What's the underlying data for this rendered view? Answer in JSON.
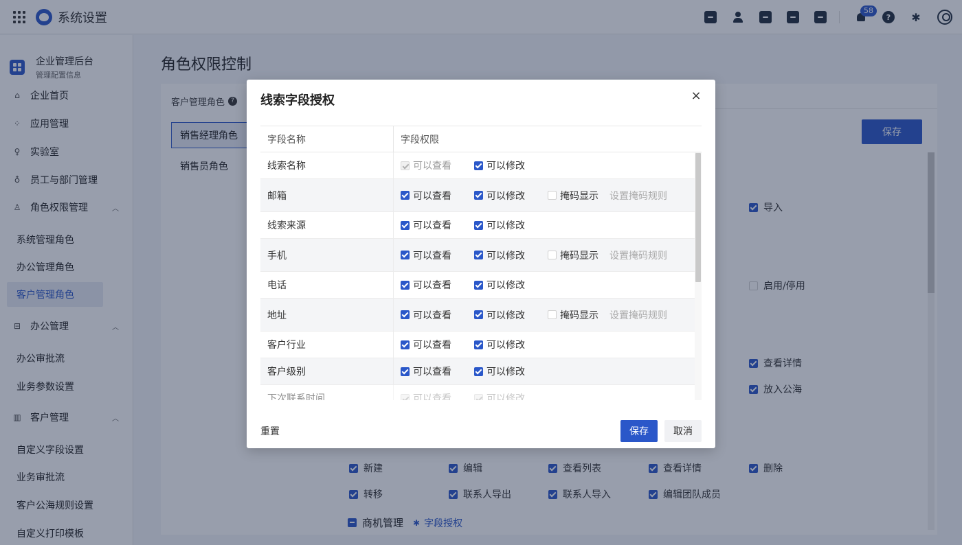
{
  "app": {
    "title": "系统设置",
    "notification_count": "58"
  },
  "sidebar": {
    "org_name": "企业管理后台",
    "org_sub": "管理配置信息",
    "items": [
      {
        "label": "企业首页",
        "icon": "home-icon",
        "glyph": "⌂"
      },
      {
        "label": "应用管理",
        "icon": "apps-icon",
        "glyph": "⁘"
      },
      {
        "label": "实验室",
        "icon": "bulb-icon",
        "glyph": "♀"
      },
      {
        "label": "员工与部门管理",
        "icon": "people-icon",
        "glyph": "♁"
      },
      {
        "label": "角色权限管理",
        "icon": "role-icon",
        "glyph": "♙"
      },
      {
        "label": "办公管理",
        "icon": "briefcase-icon",
        "glyph": "⊟"
      },
      {
        "label": "客户管理",
        "icon": "building-icon",
        "glyph": "▥"
      }
    ],
    "role_subs": [
      "系统管理角色",
      "办公管理角色",
      "客户管理角色"
    ],
    "office_subs": [
      "办公审批流",
      "业务参数设置"
    ],
    "customer_subs": [
      "自定义字段设置",
      "业务审批流",
      "客户公海规则设置",
      "自定义打印模板"
    ]
  },
  "main": {
    "page_title": "角色权限控制",
    "role_group": "客户管理角色",
    "roles": [
      "销售经理角色",
      "销售员角色"
    ],
    "save_label": "保存",
    "bg_perms": {
      "import": "导入",
      "enable_disable": "启用/停用",
      "view_detail": "查看详情",
      "to_pool": "放入公海"
    },
    "contact_perms": [
      "新建",
      "编辑",
      "查看列表",
      "查看详情",
      "删除",
      "转移",
      "联系人导出",
      "联系人导入",
      "编辑团队成员"
    ],
    "opportunity_section": "商机管理",
    "field_auth_label": "字段授权"
  },
  "modal": {
    "title": "线索字段授权",
    "close_glyph": "×",
    "col_field": "字段名称",
    "col_perm": "字段权限",
    "view_label": "可以查看",
    "edit_label": "可以修改",
    "mask_label": "掩码显示",
    "mask_rule_label": "设置掩码规则",
    "rows": [
      {
        "name": "线索名称"
      },
      {
        "name": "邮箱"
      },
      {
        "name": "线索来源"
      },
      {
        "name": "手机"
      },
      {
        "name": "电话"
      },
      {
        "name": "地址"
      },
      {
        "name": "客户行业"
      },
      {
        "name": "客户级别"
      },
      {
        "name": "下次联系时间"
      }
    ],
    "reset_label": "重置",
    "save_label": "保存",
    "cancel_label": "取消"
  }
}
